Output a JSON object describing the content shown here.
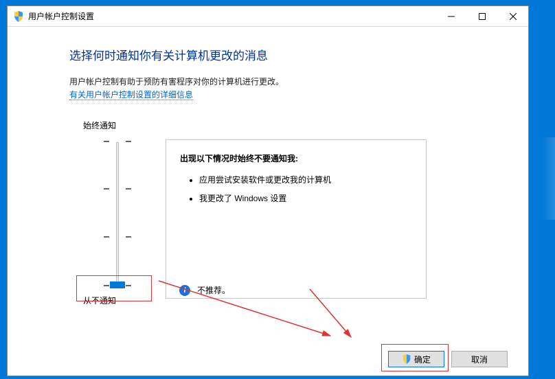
{
  "titlebar": {
    "title": "用户帐户控制设置"
  },
  "heading": "选择何时通知你有关计算机更改的消息",
  "description": "用户帐户控制有助于预防有害程序对你的计算机进行更改。",
  "link": "有关用户帐户控制设置的详细信息",
  "slider": {
    "top_label": "始终通知",
    "bottom_label": "从不通知",
    "level": 0
  },
  "panel": {
    "title": "出现以下情况时始终不要通知我:",
    "items": [
      "应用尝试安装软件或更改我的计算机",
      "我更改了 Windows 设置"
    ]
  },
  "recommend": "不推荐。",
  "buttons": {
    "ok": "确定",
    "cancel": "取消"
  }
}
